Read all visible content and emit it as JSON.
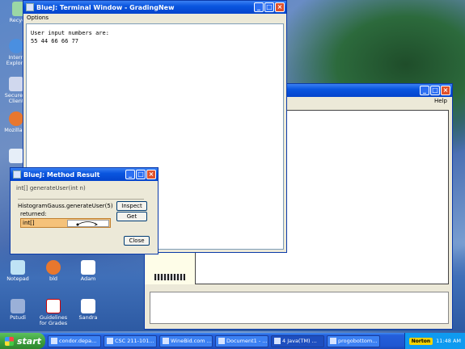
{
  "desktop": {
    "icons": [
      {
        "label": "Recycle"
      },
      {
        "label": "Intern Explore"
      },
      {
        "label": "Secure S Client"
      },
      {
        "label": "Mozilla Fi"
      },
      {
        "label": ""
      },
      {
        "label": "Notepad"
      },
      {
        "label": "bld"
      },
      {
        "label": "Adam"
      },
      {
        "label": "Pstudi"
      },
      {
        "label": "Guidelines for Grades"
      },
      {
        "label": "Sandra"
      }
    ]
  },
  "terminal": {
    "title": "BlueJ:  Terminal Window - GradingNew",
    "menu": "Options",
    "lines": [
      "User input numbers are:",
      "55 44 66 66 77"
    ]
  },
  "background_window": {
    "menu_help": "Help"
  },
  "method_result": {
    "title": "BlueJ:  Method Result",
    "signature": "int[] generateUser(int n)",
    "call": "HistogramGauss.generateUser(5)",
    "returned_label": "returned:",
    "return_type": "int[]",
    "inspect_label": "Inspect",
    "get_label": "Get",
    "close_label": "Close"
  },
  "taskbar": {
    "start_label": "start",
    "tasks": [
      {
        "label": "condor.depa..."
      },
      {
        "label": "CSC 211-101..."
      },
      {
        "label": "WineBid.com ..."
      },
      {
        "label": "Document1 - ..."
      },
      {
        "label": "4 Java(TM) ..."
      },
      {
        "label": "progobottom..."
      }
    ],
    "norton_label": "Norton",
    "clock": "11:48 AM"
  },
  "colors": {
    "title_blue": "#0a56df",
    "taskbar_blue": "#245edb",
    "start_green": "#3a9b3a",
    "highlight_orange": "#f5c27a"
  }
}
